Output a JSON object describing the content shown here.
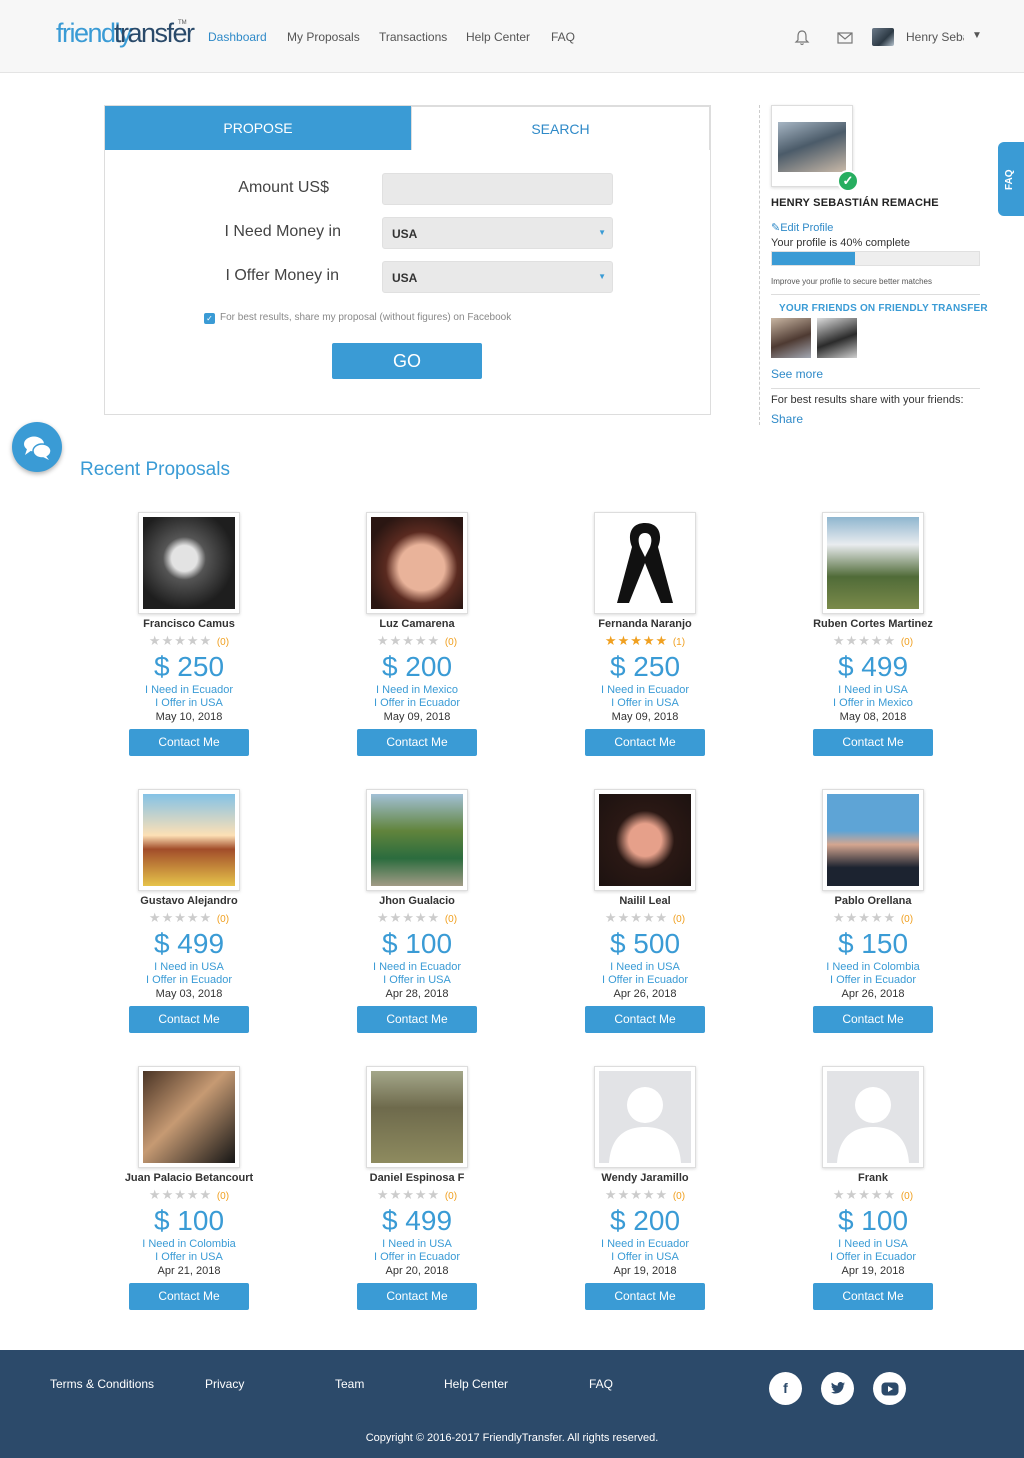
{
  "header": {
    "logo_part1": "friendly",
    "logo_part2": "transfer",
    "logo_tm": "TM",
    "nav": [
      "Dashboard",
      "My Proposals",
      "Transactions",
      "Help Center",
      "FAQ"
    ],
    "active_nav": "Dashboard",
    "user_name": "Henry Sebastián",
    "caret": "▼"
  },
  "form": {
    "tabs": {
      "propose": "PROPOSE",
      "search": "SEARCH"
    },
    "amount_label": "Amount US$",
    "amount_value": "",
    "need_label": "I Need Money in",
    "need_value": "USA",
    "offer_label": "I Offer Money in",
    "offer_value": "USA",
    "share_checked": true,
    "share_text": "For best results, share my proposal (without figures) on Facebook",
    "go_label": "GO"
  },
  "profile": {
    "name": "HENRY SEBASTIÁN REMACHE",
    "edit_label": "Edit Profile",
    "completion_text": "Your profile is 40% complete",
    "completion_pct": 40,
    "improve_text": "Improve your profile to secure better matches",
    "friends_title": "YOUR FRIENDS ON FRIENDLY TRANSFER",
    "see_more": "See more",
    "share_text": "For best results share with your friends:",
    "share_link": "Share"
  },
  "faq_tab": "FAQ",
  "recent_title": "Recent Proposals",
  "proposals": [
    {
      "name": "Francisco Camus",
      "stars": 0,
      "reviews": "(0)",
      "amount": "$ 250",
      "need": "I Need in Ecuador",
      "offer": "I Offer in USA",
      "date": "May 10, 2018",
      "contact": "Contact Me"
    },
    {
      "name": "Luz Camarena",
      "stars": 0,
      "reviews": "(0)",
      "amount": "$ 200",
      "need": "I Need in Mexico",
      "offer": "I Offer in Ecuador",
      "date": "May 09, 2018",
      "contact": "Contact Me"
    },
    {
      "name": "Fernanda Naranjo",
      "stars": 5,
      "reviews": "(1)",
      "amount": "$ 250",
      "need": "I Need in Ecuador",
      "offer": "I Offer in USA",
      "date": "May 09, 2018",
      "contact": "Contact Me"
    },
    {
      "name": "Ruben Cortes Martinez",
      "stars": 0,
      "reviews": "(0)",
      "amount": "$ 499",
      "need": "I Need in USA",
      "offer": "I Offer in Mexico",
      "date": "May 08, 2018",
      "contact": "Contact Me"
    },
    {
      "name": "Gustavo Alejandro",
      "stars": 0,
      "reviews": "(0)",
      "amount": "$ 499",
      "need": "I Need in USA",
      "offer": "I Offer in Ecuador",
      "date": "May 03, 2018",
      "contact": "Contact Me"
    },
    {
      "name": "Jhon Gualacio",
      "stars": 0,
      "reviews": "(0)",
      "amount": "$ 100",
      "need": "I Need in Ecuador",
      "offer": "I Offer in USA",
      "date": "Apr 28, 2018",
      "contact": "Contact Me"
    },
    {
      "name": "Nailil Leal",
      "stars": 0,
      "reviews": "(0)",
      "amount": "$ 500",
      "need": "I Need in USA",
      "offer": "I Offer in Ecuador",
      "date": "Apr 26, 2018",
      "contact": "Contact Me"
    },
    {
      "name": "Pablo Orellana",
      "stars": 0,
      "reviews": "(0)",
      "amount": "$ 150",
      "need": "I Need in Colombia",
      "offer": "I Offer in Ecuador",
      "date": "Apr 26, 2018",
      "contact": "Contact Me"
    },
    {
      "name": "Juan Palacio Betancourt",
      "stars": 0,
      "reviews": "(0)",
      "amount": "$ 100",
      "need": "I Need in Colombia",
      "offer": "I Offer in USA",
      "date": "Apr 21, 2018",
      "contact": "Contact Me"
    },
    {
      "name": "Daniel Espinosa F",
      "stars": 0,
      "reviews": "(0)",
      "amount": "$ 499",
      "need": "I Need in USA",
      "offer": "I Offer in Ecuador",
      "date": "Apr 20, 2018",
      "contact": "Contact Me"
    },
    {
      "name": "Wendy Jaramillo",
      "stars": 0,
      "reviews": "(0)",
      "amount": "$ 200",
      "need": "I Need in Ecuador",
      "offer": "I Offer in USA",
      "date": "Apr 19, 2018",
      "contact": "Contact Me"
    },
    {
      "name": "Frank",
      "stars": 0,
      "reviews": "(0)",
      "amount": "$ 100",
      "need": "I Need in USA",
      "offer": "I Offer in Ecuador",
      "date": "Apr 19, 2018",
      "contact": "Contact Me"
    }
  ],
  "footer": {
    "links": [
      "Terms & Conditions",
      "Privacy",
      "Team",
      "Help Center",
      "FAQ"
    ],
    "social": [
      "facebook-icon",
      "twitter-icon",
      "youtube-icon"
    ],
    "copyright": "Copyright © 2016-2017 FriendlyTransfer. All rights reserved."
  },
  "colors": {
    "accent": "#3a9bd5",
    "footer": "#2c4a6a",
    "star": "#f0a020",
    "verified": "#27ae60"
  }
}
